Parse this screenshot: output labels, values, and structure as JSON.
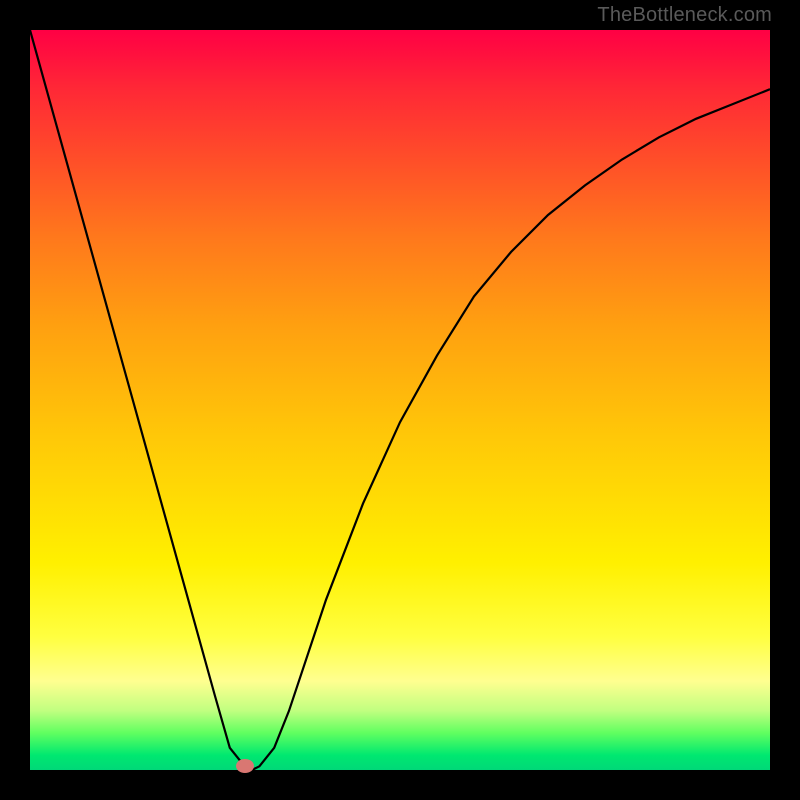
{
  "attribution": "TheBottleneck.com",
  "chart_data": {
    "type": "line",
    "title": "",
    "xlabel": "",
    "ylabel": "",
    "xlim": [
      0,
      100
    ],
    "ylim": [
      0,
      100
    ],
    "series": [
      {
        "name": "curve",
        "x": [
          0,
          5,
          10,
          15,
          20,
          25,
          27,
          29,
          30,
          31,
          33,
          35,
          40,
          45,
          50,
          55,
          60,
          65,
          70,
          75,
          80,
          85,
          90,
          95,
          100
        ],
        "values": [
          100,
          82,
          64,
          46,
          28,
          10,
          3,
          0.5,
          0,
          0.5,
          3,
          8,
          23,
          36,
          47,
          56,
          64,
          70,
          75,
          79,
          82.5,
          85.5,
          88,
          90,
          92
        ]
      }
    ],
    "marker": {
      "x": 29,
      "y": 0.5
    },
    "gradient_stops": [
      {
        "pos": 0,
        "color": "#ff0044"
      },
      {
        "pos": 8,
        "color": "#ff2836"
      },
      {
        "pos": 18,
        "color": "#ff5028"
      },
      {
        "pos": 28,
        "color": "#ff781c"
      },
      {
        "pos": 40,
        "color": "#ffa010"
      },
      {
        "pos": 55,
        "color": "#ffc808"
      },
      {
        "pos": 72,
        "color": "#fff000"
      },
      {
        "pos": 82,
        "color": "#ffff40"
      },
      {
        "pos": 88,
        "color": "#ffff90"
      },
      {
        "pos": 92,
        "color": "#c0ff80"
      },
      {
        "pos": 95,
        "color": "#60ff60"
      },
      {
        "pos": 98,
        "color": "#00e870"
      },
      {
        "pos": 100,
        "color": "#00d878"
      }
    ]
  }
}
